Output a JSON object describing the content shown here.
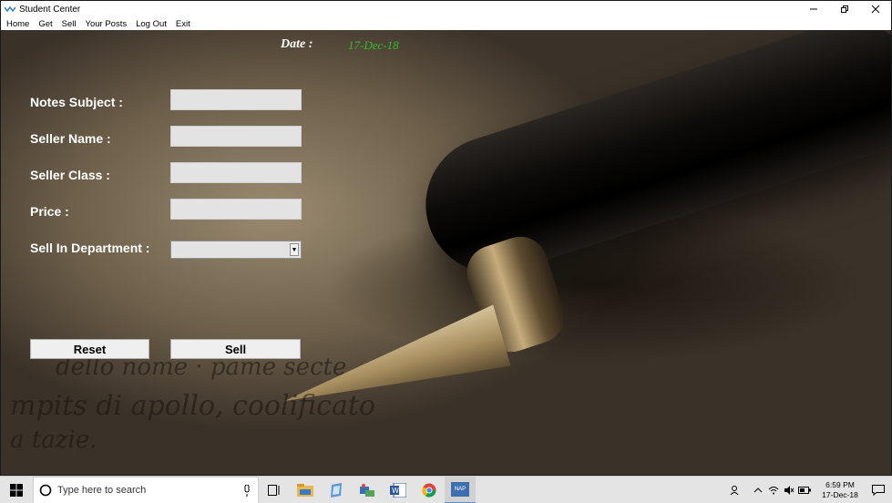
{
  "window": {
    "title": "Student Center",
    "menu": [
      "Home",
      "Get",
      "Sell",
      "Your Posts",
      "Log Out",
      "Exit"
    ]
  },
  "date": {
    "label": "Date :",
    "value": "17-Dec-18"
  },
  "form": {
    "notes_subject_label": "Notes Subject :",
    "seller_name_label": "Seller Name :",
    "seller_class_label": "Seller Class :",
    "price_label": "Price :",
    "department_label": "Sell In Department :",
    "notes_subject_value": "",
    "seller_name_value": "",
    "seller_class_value": "",
    "price_value": "",
    "department_value": "",
    "reset_label": "Reset",
    "sell_label": "Sell"
  },
  "background_script": {
    "line1": "dello nome · pame secte",
    "line2": "mpits di apollo, coolificato",
    "line3": "a tazie."
  },
  "taskbar": {
    "search_placeholder": "Type here to search",
    "active_app": "NAP",
    "time": "6:59 PM",
    "date": "17-Dec-18"
  },
  "colors": {
    "date_value": "#2fbf2f",
    "label_text": "#ffffff",
    "input_bg": "#e3e3e3"
  }
}
